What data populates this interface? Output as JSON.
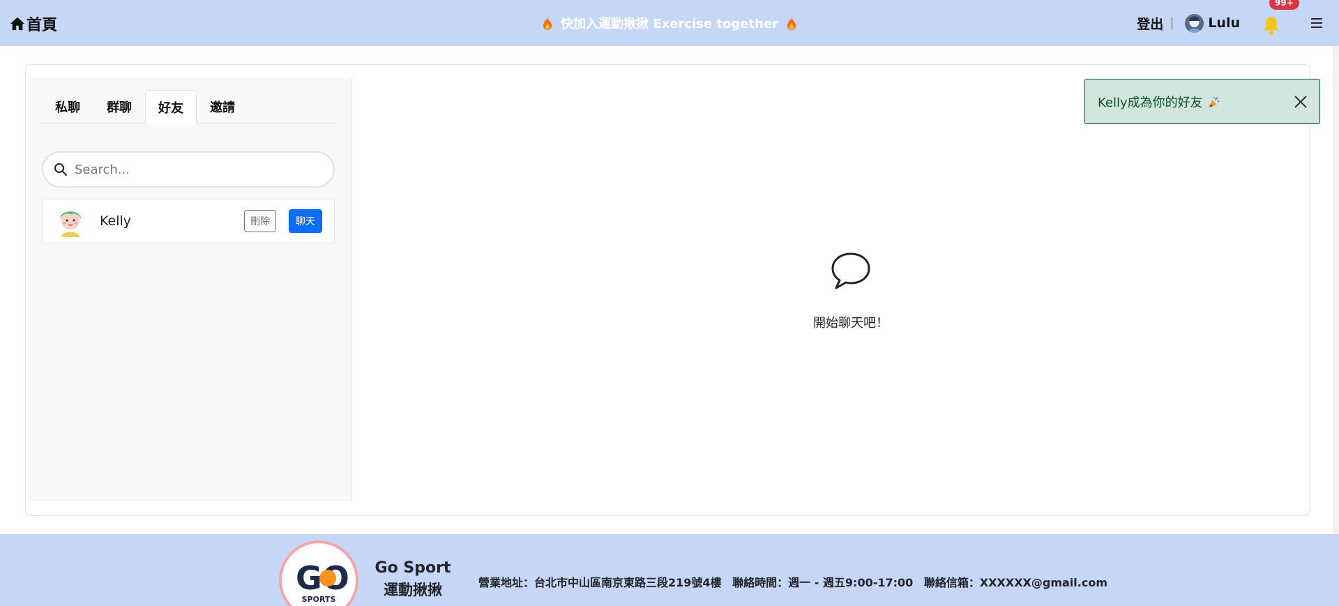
{
  "navbar": {
    "home_label": "首頁",
    "marquee_text": "快加入運動揪揪 Exercise together",
    "logout_label": "登出",
    "user_name": "Lulu",
    "notification_count": "99+"
  },
  "tabs": [
    {
      "label": "私聊",
      "active": false
    },
    {
      "label": "群聊",
      "active": false
    },
    {
      "label": "好友",
      "active": true
    },
    {
      "label": "邀請",
      "active": false
    }
  ],
  "search": {
    "placeholder": "Search...",
    "value": ""
  },
  "friends": [
    {
      "name": "Kelly",
      "delete_label": "刪除",
      "chat_label": "聊天"
    }
  ],
  "empty_state": {
    "text": "開始聊天吧！"
  },
  "toast": {
    "message": "Kelly成為你的好友"
  },
  "footer": {
    "brand_en": "Go Sport",
    "brand_zh": "運動揪揪",
    "logo_text": "GO",
    "logo_sub": "SPORTS",
    "address": "營業地址：台北市中山區南京東路三段219號4樓",
    "hours": "聯絡時間：週一 - 週五9:00-17:00",
    "email": "聯絡信箱：XXXXXX@gmail.com"
  },
  "colors": {
    "navbar_bg": "#c6d6f8",
    "primary": "#0d6efd",
    "danger_badge": "#dc3545",
    "toast_bg": "#d1e7dd",
    "toast_border": "#0f5132"
  }
}
